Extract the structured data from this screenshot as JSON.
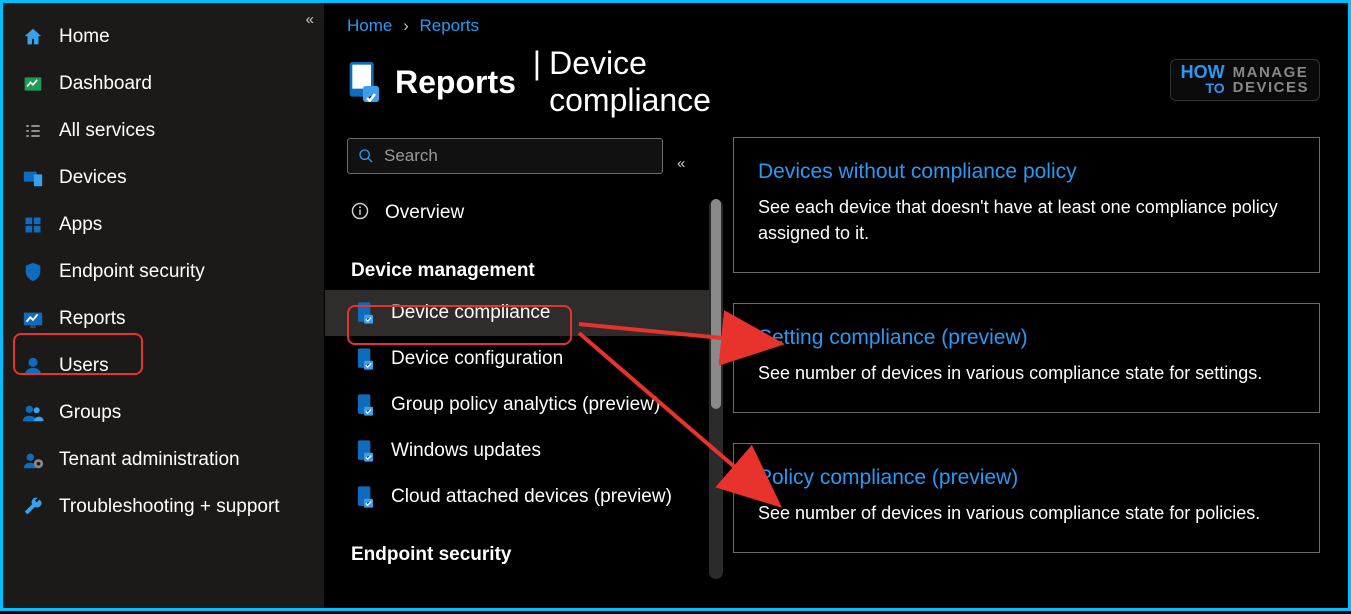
{
  "sidebar": {
    "items": [
      {
        "label": "Home"
      },
      {
        "label": "Dashboard"
      },
      {
        "label": "All services"
      },
      {
        "label": "Devices"
      },
      {
        "label": "Apps"
      },
      {
        "label": "Endpoint security"
      },
      {
        "label": "Reports"
      },
      {
        "label": "Users"
      },
      {
        "label": "Groups"
      },
      {
        "label": "Tenant administration"
      },
      {
        "label": "Troubleshooting + support"
      }
    ]
  },
  "breadcrumb": {
    "home": "Home",
    "reports": "Reports"
  },
  "header": {
    "title": "Reports",
    "subtitle": "Device compliance"
  },
  "search": {
    "placeholder": "Search"
  },
  "secondary_nav": {
    "overview": "Overview",
    "section_dm": "Device management",
    "items": [
      {
        "label": "Device compliance"
      },
      {
        "label": "Device configuration"
      },
      {
        "label": "Group policy analytics (preview)"
      },
      {
        "label": "Windows updates"
      },
      {
        "label": "Cloud attached devices (preview)"
      }
    ],
    "section_es": "Endpoint security"
  },
  "cards": [
    {
      "title": "Devices without compliance policy",
      "desc": "See each device that doesn't have at least one compliance policy assigned to it."
    },
    {
      "title": "Setting compliance (preview)",
      "desc": "See number of devices in various compliance state for settings."
    },
    {
      "title": "Policy compliance (preview)",
      "desc": "See number of devices in various compliance state for policies."
    }
  ],
  "watermark": {
    "how": "HOW",
    "to": "TO",
    "manage": "MANAGE",
    "devices": "DEVICES"
  }
}
